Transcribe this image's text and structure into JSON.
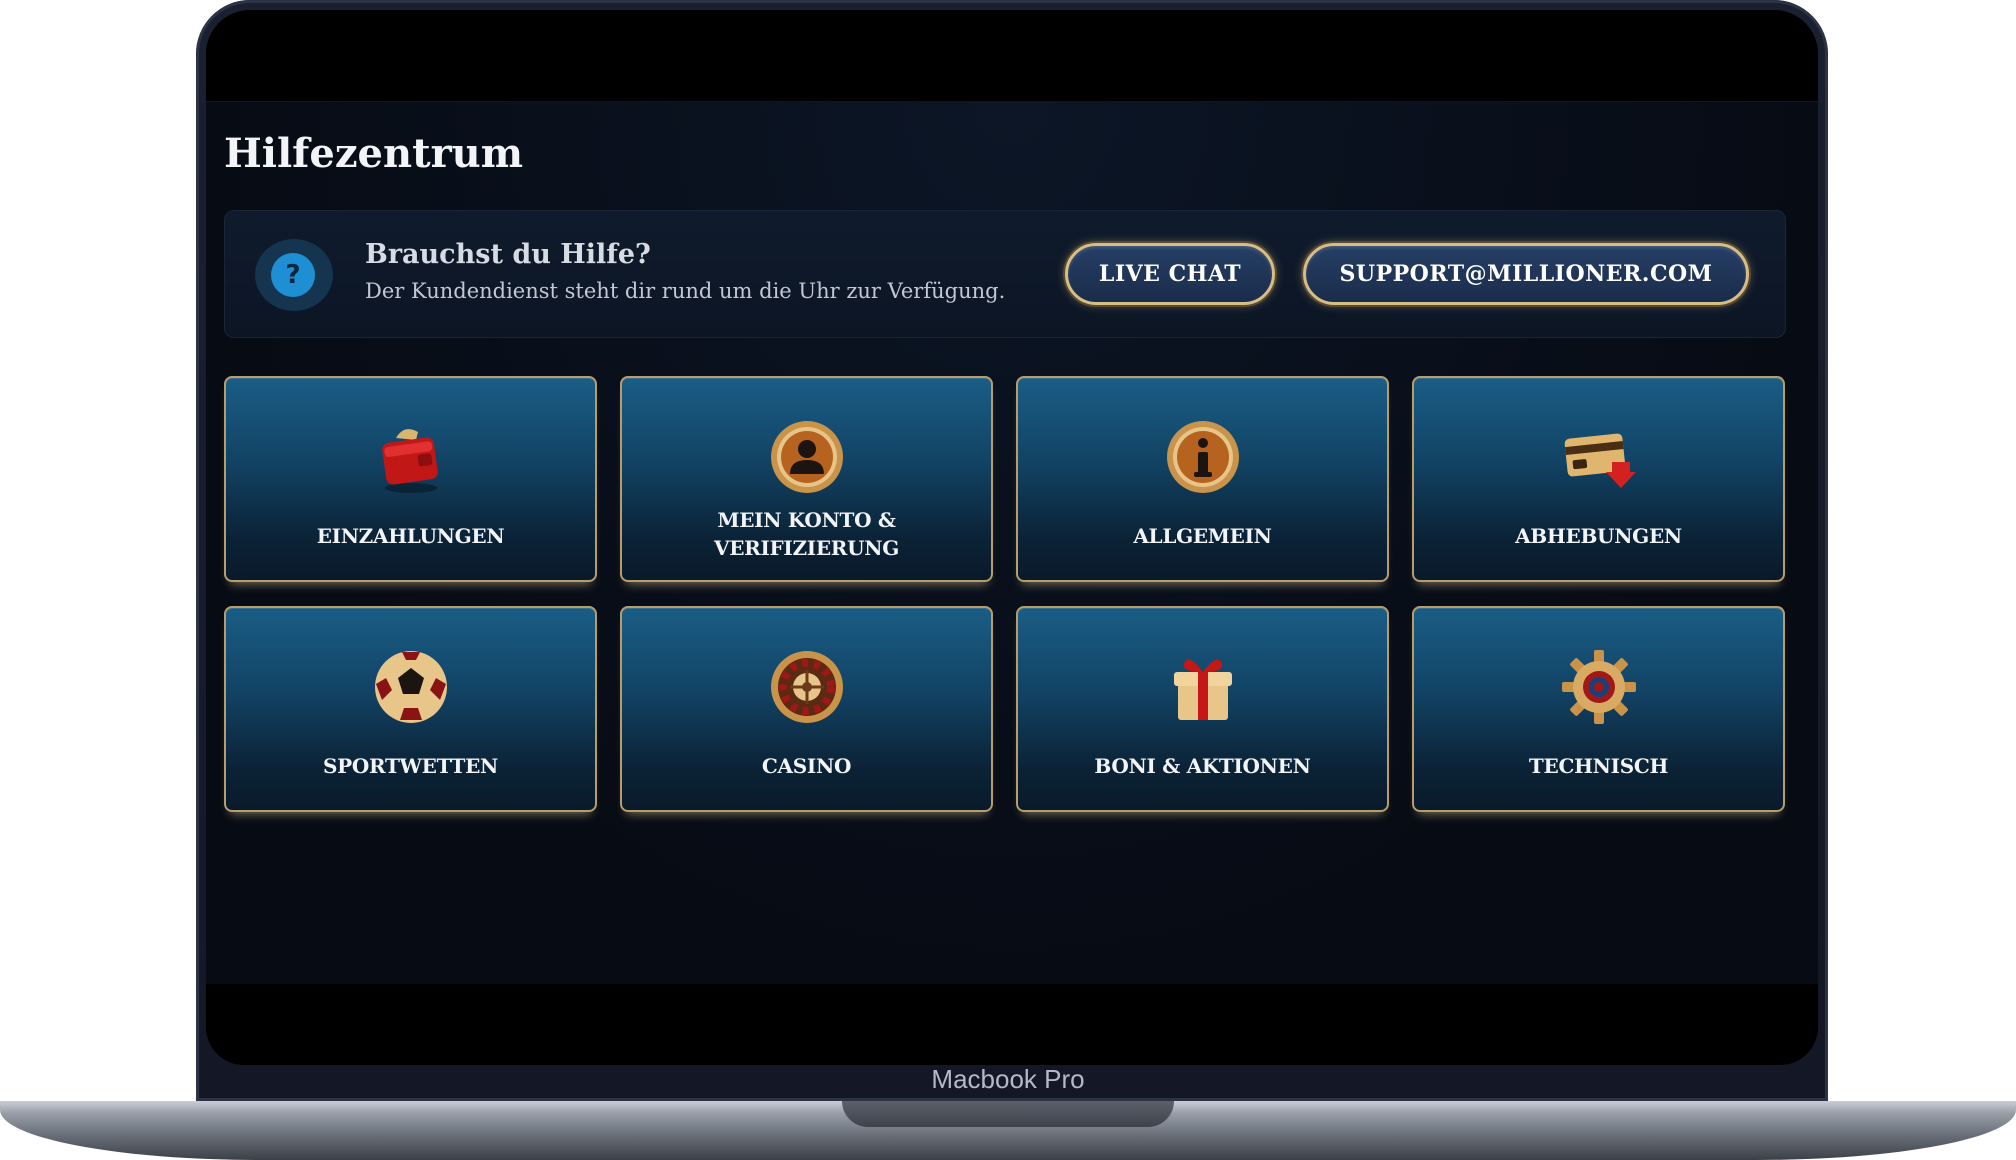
{
  "device": {
    "label": "Macbook Pro"
  },
  "page": {
    "title": "Hilfezentrum"
  },
  "help_banner": {
    "icon": "question-circle-icon",
    "question_mark": "?",
    "title": "Brauchst du Hilfe?",
    "subtitle": "Der Kundendienst steht dir rund um die Uhr zur Verfügung.",
    "live_chat_label": "LIVE CHAT",
    "email_label": "SUPPORT@MILLIONER.COM"
  },
  "categories": [
    {
      "label_lines": [
        "EINZAHLUNGEN"
      ],
      "icon": "wallet-icon"
    },
    {
      "label_lines": [
        "MEIN KONTO &",
        "VERIFIZIERUNG"
      ],
      "icon": "user-icon"
    },
    {
      "label_lines": [
        "ALLGEMEIN"
      ],
      "icon": "info-icon"
    },
    {
      "label_lines": [
        "ABHEBUNGEN"
      ],
      "icon": "card-withdraw-icon"
    },
    {
      "label_lines": [
        "SPORTWETTEN"
      ],
      "icon": "soccer-ball-icon"
    },
    {
      "label_lines": [
        "CASINO"
      ],
      "icon": "roulette-icon"
    },
    {
      "label_lines": [
        "BONI & AKTIONEN"
      ],
      "icon": "gift-icon"
    },
    {
      "label_lines": [
        "TECHNISCH"
      ],
      "icon": "gear-icon"
    }
  ],
  "colors": {
    "accent_gold": "#b79d6b",
    "tile_blue": "#1a5d85",
    "background": "#070b14"
  }
}
